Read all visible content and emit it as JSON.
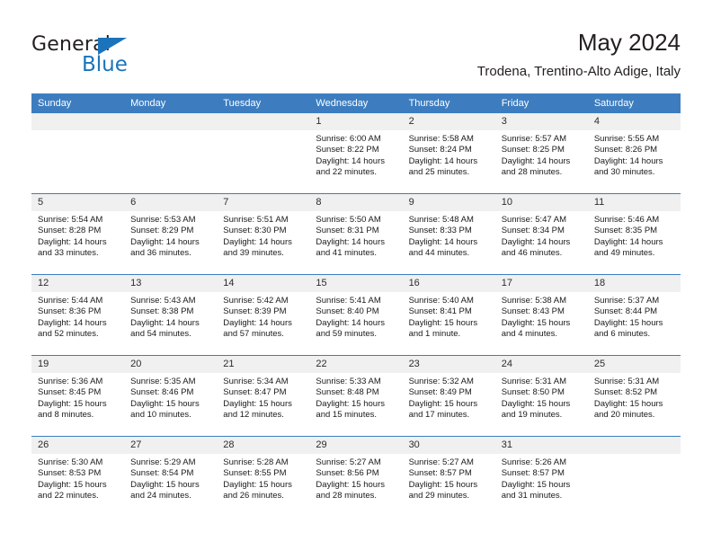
{
  "logo": {
    "word1": "General",
    "word2": "Blue",
    "triangle_color": "#1b74bb"
  },
  "header": {
    "title": "May 2024",
    "subtitle": "Trodena, Trentino-Alto Adige, Italy",
    "header_bg": "#3d7dbf",
    "daynum_bg": "#f0f0f0"
  },
  "weekdays": [
    "Sunday",
    "Monday",
    "Tuesday",
    "Wednesday",
    "Thursday",
    "Friday",
    "Saturday"
  ],
  "labels": {
    "sunrise": "Sunrise:",
    "sunset": "Sunset:",
    "daylight": "Daylight:"
  },
  "weeks": [
    [
      {
        "day": "",
        "empty": true
      },
      {
        "day": "",
        "empty": true
      },
      {
        "day": "",
        "empty": true
      },
      {
        "day": "1",
        "sunrise": "Sunrise: 6:00 AM",
        "sunset": "Sunset: 8:22 PM",
        "daylight1": "Daylight: 14 hours",
        "daylight2": "and 22 minutes."
      },
      {
        "day": "2",
        "sunrise": "Sunrise: 5:58 AM",
        "sunset": "Sunset: 8:24 PM",
        "daylight1": "Daylight: 14 hours",
        "daylight2": "and 25 minutes."
      },
      {
        "day": "3",
        "sunrise": "Sunrise: 5:57 AM",
        "sunset": "Sunset: 8:25 PM",
        "daylight1": "Daylight: 14 hours",
        "daylight2": "and 28 minutes."
      },
      {
        "day": "4",
        "sunrise": "Sunrise: 5:55 AM",
        "sunset": "Sunset: 8:26 PM",
        "daylight1": "Daylight: 14 hours",
        "daylight2": "and 30 minutes."
      }
    ],
    [
      {
        "day": "5",
        "sunrise": "Sunrise: 5:54 AM",
        "sunset": "Sunset: 8:28 PM",
        "daylight1": "Daylight: 14 hours",
        "daylight2": "and 33 minutes."
      },
      {
        "day": "6",
        "sunrise": "Sunrise: 5:53 AM",
        "sunset": "Sunset: 8:29 PM",
        "daylight1": "Daylight: 14 hours",
        "daylight2": "and 36 minutes."
      },
      {
        "day": "7",
        "sunrise": "Sunrise: 5:51 AM",
        "sunset": "Sunset: 8:30 PM",
        "daylight1": "Daylight: 14 hours",
        "daylight2": "and 39 minutes."
      },
      {
        "day": "8",
        "sunrise": "Sunrise: 5:50 AM",
        "sunset": "Sunset: 8:31 PM",
        "daylight1": "Daylight: 14 hours",
        "daylight2": "and 41 minutes."
      },
      {
        "day": "9",
        "sunrise": "Sunrise: 5:48 AM",
        "sunset": "Sunset: 8:33 PM",
        "daylight1": "Daylight: 14 hours",
        "daylight2": "and 44 minutes."
      },
      {
        "day": "10",
        "sunrise": "Sunrise: 5:47 AM",
        "sunset": "Sunset: 8:34 PM",
        "daylight1": "Daylight: 14 hours",
        "daylight2": "and 46 minutes."
      },
      {
        "day": "11",
        "sunrise": "Sunrise: 5:46 AM",
        "sunset": "Sunset: 8:35 PM",
        "daylight1": "Daylight: 14 hours",
        "daylight2": "and 49 minutes."
      }
    ],
    [
      {
        "day": "12",
        "sunrise": "Sunrise: 5:44 AM",
        "sunset": "Sunset: 8:36 PM",
        "daylight1": "Daylight: 14 hours",
        "daylight2": "and 52 minutes."
      },
      {
        "day": "13",
        "sunrise": "Sunrise: 5:43 AM",
        "sunset": "Sunset: 8:38 PM",
        "daylight1": "Daylight: 14 hours",
        "daylight2": "and 54 minutes."
      },
      {
        "day": "14",
        "sunrise": "Sunrise: 5:42 AM",
        "sunset": "Sunset: 8:39 PM",
        "daylight1": "Daylight: 14 hours",
        "daylight2": "and 57 minutes."
      },
      {
        "day": "15",
        "sunrise": "Sunrise: 5:41 AM",
        "sunset": "Sunset: 8:40 PM",
        "daylight1": "Daylight: 14 hours",
        "daylight2": "and 59 minutes."
      },
      {
        "day": "16",
        "sunrise": "Sunrise: 5:40 AM",
        "sunset": "Sunset: 8:41 PM",
        "daylight1": "Daylight: 15 hours",
        "daylight2": "and 1 minute."
      },
      {
        "day": "17",
        "sunrise": "Sunrise: 5:38 AM",
        "sunset": "Sunset: 8:43 PM",
        "daylight1": "Daylight: 15 hours",
        "daylight2": "and 4 minutes."
      },
      {
        "day": "18",
        "sunrise": "Sunrise: 5:37 AM",
        "sunset": "Sunset: 8:44 PM",
        "daylight1": "Daylight: 15 hours",
        "daylight2": "and 6 minutes."
      }
    ],
    [
      {
        "day": "19",
        "sunrise": "Sunrise: 5:36 AM",
        "sunset": "Sunset: 8:45 PM",
        "daylight1": "Daylight: 15 hours",
        "daylight2": "and 8 minutes."
      },
      {
        "day": "20",
        "sunrise": "Sunrise: 5:35 AM",
        "sunset": "Sunset: 8:46 PM",
        "daylight1": "Daylight: 15 hours",
        "daylight2": "and 10 minutes."
      },
      {
        "day": "21",
        "sunrise": "Sunrise: 5:34 AM",
        "sunset": "Sunset: 8:47 PM",
        "daylight1": "Daylight: 15 hours",
        "daylight2": "and 12 minutes."
      },
      {
        "day": "22",
        "sunrise": "Sunrise: 5:33 AM",
        "sunset": "Sunset: 8:48 PM",
        "daylight1": "Daylight: 15 hours",
        "daylight2": "and 15 minutes."
      },
      {
        "day": "23",
        "sunrise": "Sunrise: 5:32 AM",
        "sunset": "Sunset: 8:49 PM",
        "daylight1": "Daylight: 15 hours",
        "daylight2": "and 17 minutes."
      },
      {
        "day": "24",
        "sunrise": "Sunrise: 5:31 AM",
        "sunset": "Sunset: 8:50 PM",
        "daylight1": "Daylight: 15 hours",
        "daylight2": "and 19 minutes."
      },
      {
        "day": "25",
        "sunrise": "Sunrise: 5:31 AM",
        "sunset": "Sunset: 8:52 PM",
        "daylight1": "Daylight: 15 hours",
        "daylight2": "and 20 minutes."
      }
    ],
    [
      {
        "day": "26",
        "sunrise": "Sunrise: 5:30 AM",
        "sunset": "Sunset: 8:53 PM",
        "daylight1": "Daylight: 15 hours",
        "daylight2": "and 22 minutes."
      },
      {
        "day": "27",
        "sunrise": "Sunrise: 5:29 AM",
        "sunset": "Sunset: 8:54 PM",
        "daylight1": "Daylight: 15 hours",
        "daylight2": "and 24 minutes."
      },
      {
        "day": "28",
        "sunrise": "Sunrise: 5:28 AM",
        "sunset": "Sunset: 8:55 PM",
        "daylight1": "Daylight: 15 hours",
        "daylight2": "and 26 minutes."
      },
      {
        "day": "29",
        "sunrise": "Sunrise: 5:27 AM",
        "sunset": "Sunset: 8:56 PM",
        "daylight1": "Daylight: 15 hours",
        "daylight2": "and 28 minutes."
      },
      {
        "day": "30",
        "sunrise": "Sunrise: 5:27 AM",
        "sunset": "Sunset: 8:57 PM",
        "daylight1": "Daylight: 15 hours",
        "daylight2": "and 29 minutes."
      },
      {
        "day": "31",
        "sunrise": "Sunrise: 5:26 AM",
        "sunset": "Sunset: 8:57 PM",
        "daylight1": "Daylight: 15 hours",
        "daylight2": "and 31 minutes."
      },
      {
        "day": "",
        "empty": true
      }
    ]
  ]
}
